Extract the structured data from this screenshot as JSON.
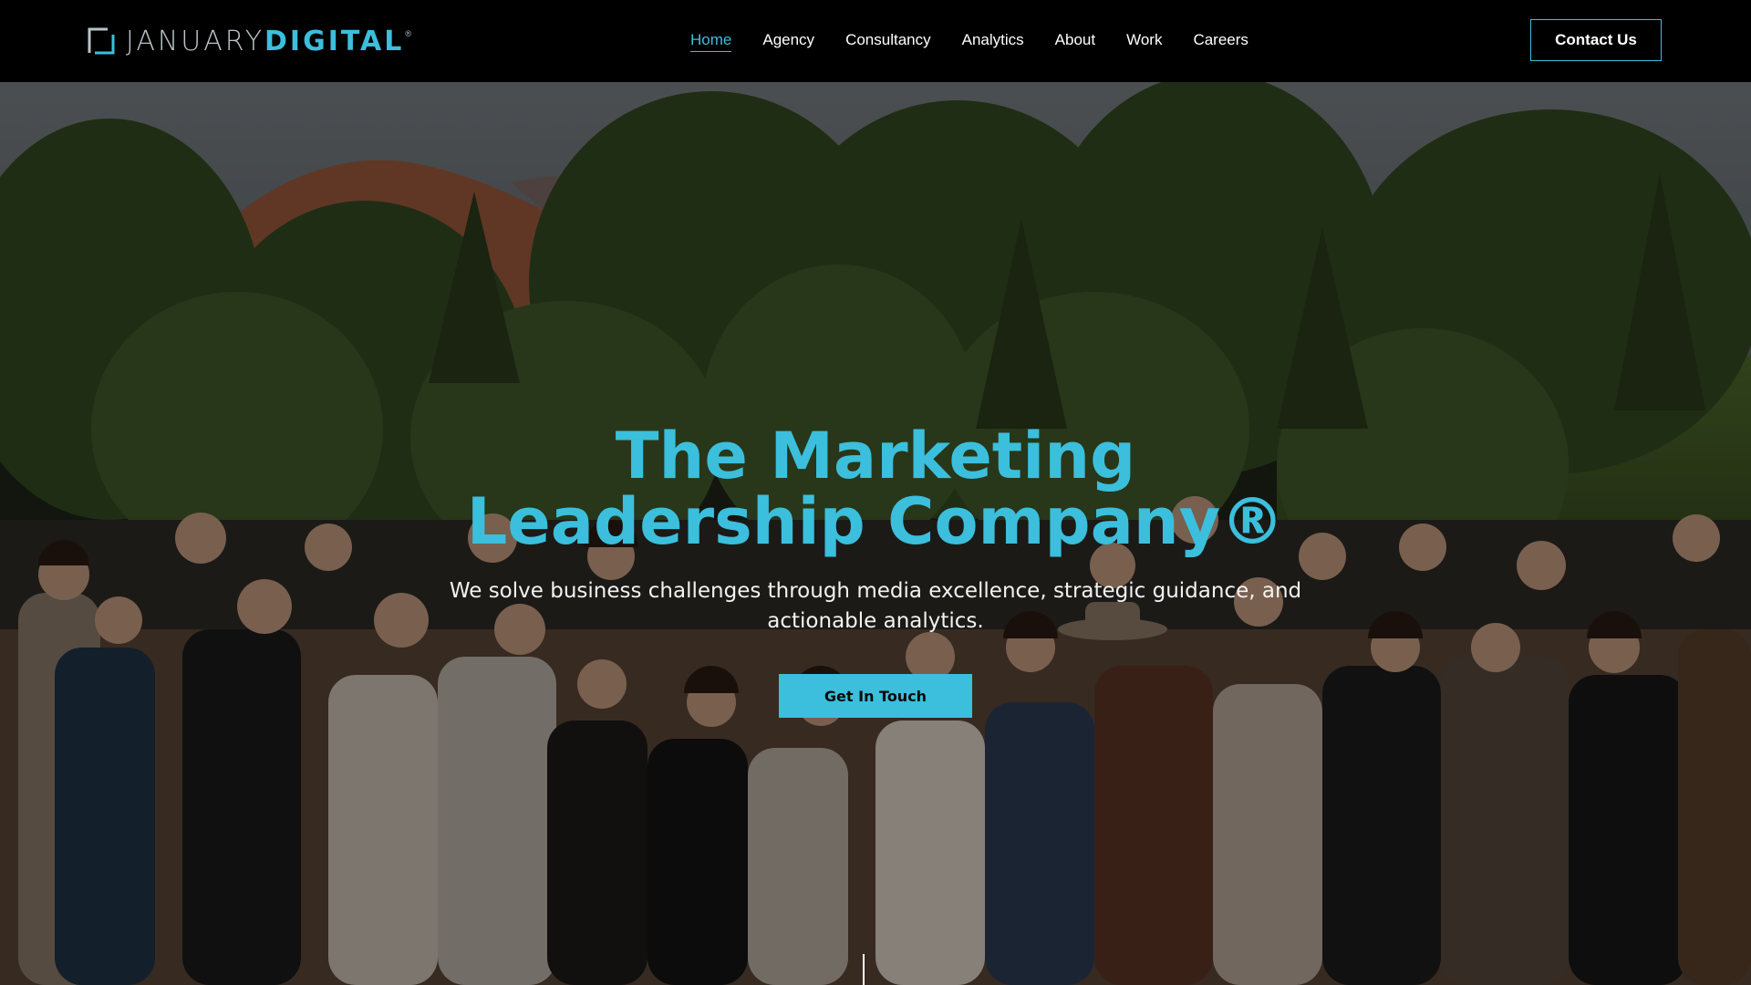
{
  "brand": {
    "name_part1": "JANUARY",
    "name_part2": "DIGITAL",
    "trademark": "®"
  },
  "nav": {
    "items": [
      {
        "label": "Home",
        "active": true
      },
      {
        "label": "Agency",
        "active": false
      },
      {
        "label": "Consultancy",
        "active": false
      },
      {
        "label": "Analytics",
        "active": false
      },
      {
        "label": "About",
        "active": false
      },
      {
        "label": "Work",
        "active": false
      },
      {
        "label": "Careers",
        "active": false
      }
    ],
    "contact_label": "Contact Us"
  },
  "hero": {
    "title": "The Marketing Leadership Company®",
    "subtitle": "We solve business challenges through media excellence, strategic guidance, and actionable analytics.",
    "cta_label": "Get In Touch",
    "background_description_icon": "team-photo-image"
  },
  "colors": {
    "accent": "#3bbfdc",
    "nav_background": "#000000",
    "text_light": "#ffffff",
    "logo_gray": "#b9c2c7"
  }
}
